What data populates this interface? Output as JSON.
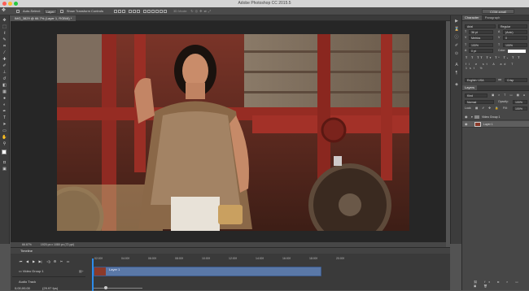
{
  "app": {
    "title": "Adobe Photoshop CC 2015.5",
    "colors": {
      "accent": "#2d8ceb",
      "clip": "#5a78a7",
      "ui_dark": "#3c3c3c"
    }
  },
  "options": {
    "auto_select_label": "Auto-Select:",
    "auto_select_value": "Layer",
    "show_transform_label": "Show Transform Controls",
    "mode_label": "3D Mode:",
    "workspace": "CGM-small"
  },
  "document": {
    "tab_title": "IMG_3829 @ 66.7% (Layer 1, RGB/8) *",
    "zoom": "66.67%",
    "doc_size": "1920 px x 1080 px (72 ppi)"
  },
  "toolbox": {
    "icons": [
      "move-icon",
      "marquee-icon",
      "lasso-icon",
      "quick-select-icon",
      "crop-icon",
      "eyedropper-icon",
      "healing-icon",
      "brush-icon",
      "stamp-icon",
      "history-brush-icon",
      "eraser-icon",
      "gradient-icon",
      "blur-icon",
      "dodge-icon",
      "pen-icon",
      "type-icon",
      "path-select-icon",
      "shape-icon",
      "hand-icon",
      "zoom-icon"
    ]
  },
  "character": {
    "tabs": [
      "Character",
      "Paragraph"
    ],
    "font_family": "Arial",
    "font_style": "Regular",
    "font_size": "36 pt",
    "leading": "(Auto)",
    "kerning": "Metrics",
    "tracking": "0",
    "vscale": "100%",
    "hscale": "100%",
    "baseline": "0 pt",
    "color_label": "Color:",
    "language": "English: USA",
    "antialias": "Crisp"
  },
  "layers": {
    "title": "Layers",
    "filter_kind": "Kind",
    "blend_mode": "Normal",
    "opacity_label": "Opacity:",
    "opacity": "100%",
    "lock_label": "Lock:",
    "fill_label": "Fill:",
    "fill": "100%",
    "items": [
      {
        "name": "Video Group 1"
      },
      {
        "name": "Layer 1"
      }
    ]
  },
  "timeline": {
    "title": "Timeline",
    "timecode": "0;00;00;00",
    "fps": "(29.97 fps)",
    "ticks": [
      "02:00f",
      "04:00f",
      "06:00f",
      "08:00f",
      "10:00f",
      "12:00f",
      "14:00f",
      "16:00f",
      "18:00f",
      "20:00f"
    ],
    "video_group": "Video Group 1",
    "clip_name": "Layer 1",
    "audio_track": "Audio Track"
  }
}
